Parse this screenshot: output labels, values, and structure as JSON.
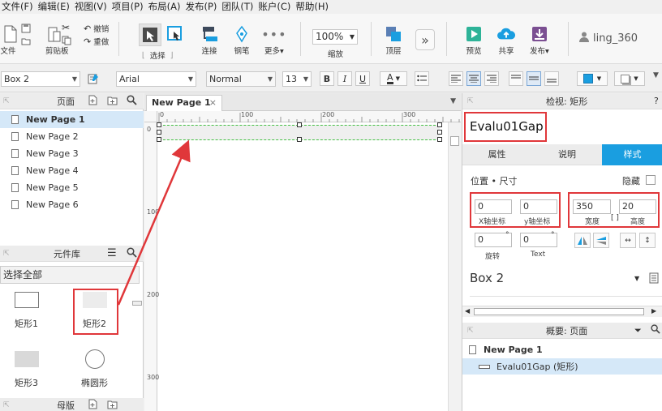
{
  "menu": [
    "文件(F)",
    "编辑(E)",
    "视图(V)",
    "项目(P)",
    "布局(A)",
    "发布(P)",
    "团队(T)",
    "账户(C)",
    "帮助(H)"
  ],
  "toolbar": {
    "file_label": "文件",
    "clipboard_label": "剪贴板",
    "undo_label": "撤销",
    "redo_label": "重做",
    "select_label": "选择",
    "connect_label": "连接",
    "pen_label": "钢笔",
    "more_label": "更多▾",
    "zoom_value": "100%",
    "zoom_label": "缩放",
    "top_layer_label": "顶层",
    "preview_label": "预览",
    "share_label": "共享",
    "publish_label": "发布▾",
    "user_name": "ling_360"
  },
  "format": {
    "element_name": "Box 2",
    "font_family": "Arial",
    "font_style": "Normal",
    "font_size": "13"
  },
  "pages_panel": {
    "title": "页面",
    "pages": [
      "New Page 1",
      "New Page 2",
      "New Page 3",
      "New Page 4",
      "New Page 5",
      "New Page 6"
    ]
  },
  "library_panel": {
    "title": "元件库",
    "filter": "选择全部",
    "widgets": [
      "矩形1",
      "矩形2",
      "矩形3",
      "椭圆形"
    ]
  },
  "masters_panel": {
    "title": "母版"
  },
  "canvas": {
    "tab": "New Page 1",
    "hruler": [
      "0",
      "100",
      "200",
      "300"
    ],
    "vruler": [
      "0",
      "100",
      "200",
      "300"
    ]
  },
  "inspector": {
    "title": "检视: 矩形",
    "shape_name": "Evalu01Gap",
    "tabs": [
      "属性",
      "说明",
      "样式"
    ],
    "section_position": "位置 • 尺寸",
    "hide_label": "隐藏",
    "x": "0",
    "y": "0",
    "x_label": "X轴坐标",
    "y_label": "y轴坐标",
    "width": "350",
    "height": "20",
    "width_label": "宽度",
    "height_label": "高度",
    "rotation": "0",
    "text_rotation": "0",
    "rotation_label": "旋转",
    "text_label": "Text",
    "style_name": "Box 2"
  },
  "outline": {
    "title": "概要: 页面",
    "page": "New Page 1",
    "item": "Evalu01Gap (矩形)"
  },
  "colors": {
    "accent": "#1a9ee0",
    "highlight": "#e0373a",
    "selection": "#d5e8f8"
  }
}
